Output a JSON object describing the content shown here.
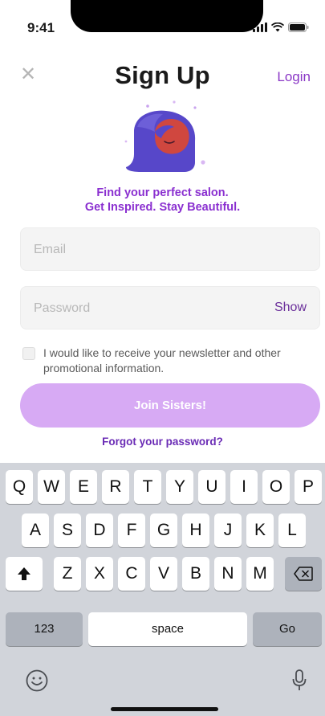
{
  "status_bar": {
    "time": "9:41",
    "icons": [
      "signal-icon",
      "wifi-icon",
      "battery-icon"
    ]
  },
  "header": {
    "close_icon": "close-icon",
    "title": "Sign Up",
    "login_label": "Login"
  },
  "tagline": {
    "line1": "Find your perfect salon.",
    "line2": "Get Inspired. Stay Beautiful."
  },
  "form": {
    "email_placeholder": "Email",
    "email_value": "",
    "password_placeholder": "Password",
    "password_value": "",
    "show_label": "Show",
    "newsletter_checked": false,
    "newsletter_label": "I would like to receive your newsletter and other promotional information.",
    "join_label": "Join Sisters!",
    "forgot_label": "Forgot your password?"
  },
  "keyboard": {
    "row1": [
      "Q",
      "W",
      "E",
      "R",
      "T",
      "Y",
      "U",
      "I",
      "O",
      "P"
    ],
    "row2": [
      "A",
      "S",
      "D",
      "F",
      "G",
      "H",
      "J",
      "K",
      "L"
    ],
    "row3": [
      "Z",
      "X",
      "C",
      "V",
      "B",
      "N",
      "M"
    ],
    "numbers_label": "123",
    "space_label": "space",
    "go_label": "Go"
  },
  "colors": {
    "accent": "#8a2fd0",
    "button_disabled": "#d7aaf4",
    "keyboard_bg": "#d1d4da"
  }
}
